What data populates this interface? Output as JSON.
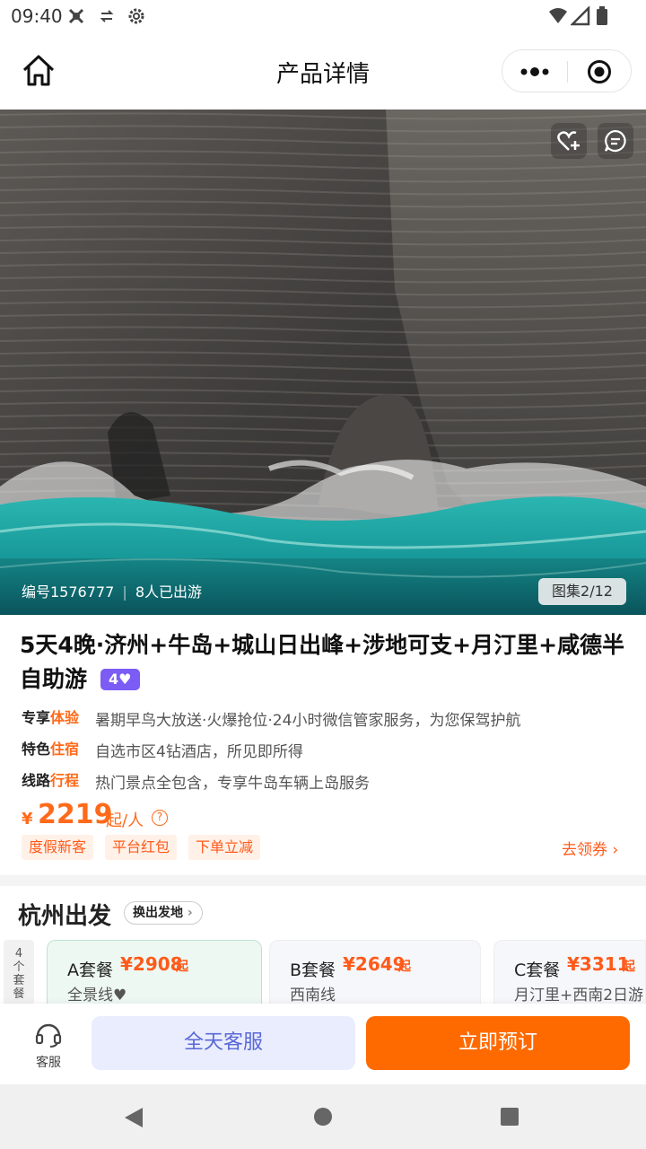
{
  "status_bar": {
    "time": "09:40",
    "icons": [
      "notification-icon",
      "data-icon",
      "settings-icon",
      "wifi-icon",
      "signal-icon",
      "battery-icon"
    ]
  },
  "header": {
    "title": "产品详情",
    "icons": [
      "home-icon",
      "more-icon",
      "record-icon"
    ]
  },
  "hero": {
    "product_id": "编号1576777",
    "travelers": "8人已出游",
    "gallery": "图集2/12",
    "icons": [
      "favorite-add-icon",
      "comment-icon"
    ]
  },
  "product": {
    "title": "5天4晚·济州+牛岛+城山日出峰+涉地可支+月汀里+咸德半自助游",
    "level": "4",
    "features": [
      {
        "tag_a": "专享",
        "tag_b": "体验",
        "text": "暑期早鸟大放送·火爆抢位·24小时微信管家服务，为您保驾护航"
      },
      {
        "tag_a": "特色",
        "tag_b": "住宿",
        "text": "自选市区4钻酒店，所见即所得"
      },
      {
        "tag_a": "线路",
        "tag_b": "行程",
        "text": "热门景点全包含，专享牛岛车辆上岛服务"
      }
    ],
    "price": {
      "currency": "¥",
      "value": "2219",
      "unit": "起/人",
      "help": "?"
    },
    "coupons": [
      "度假新客",
      "平台红包",
      "下单立减"
    ],
    "get_coupon": "去领券"
  },
  "departure": {
    "title": "杭州出发",
    "change_label": "换出发地",
    "package_count": [
      "4",
      "个",
      "套",
      "餐"
    ],
    "packages": [
      {
        "name": "A套餐",
        "price": "¥2908",
        "suffix": "起",
        "route": "全景线♥"
      },
      {
        "name": "B套餐",
        "price": "¥2649",
        "suffix": "起",
        "route": "西南线"
      },
      {
        "name": "C套餐",
        "price": "¥3311",
        "suffix": "起",
        "route": "月汀里+西南2日游"
      }
    ]
  },
  "bottom_bar": {
    "service_label": "客服",
    "service_button": "全天客服",
    "book_button": "立即预订"
  },
  "colors": {
    "accent": "#ff6a00",
    "price": "#ff5a1a",
    "level_badge": "#7b5cf5",
    "service_button_bg": "#eaedfd",
    "service_button_text": "#5968d8",
    "sea": "#1fa7a5"
  }
}
